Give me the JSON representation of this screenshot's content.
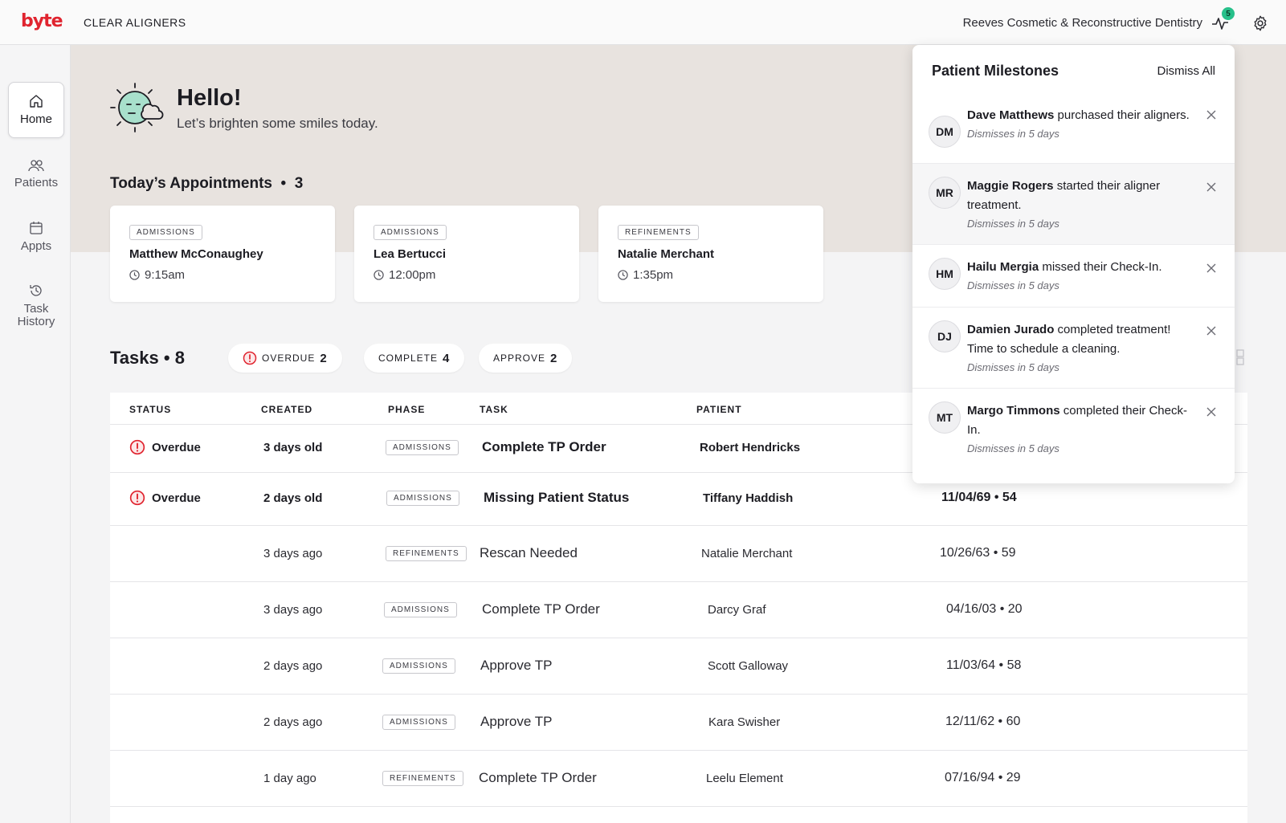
{
  "topbar": {
    "logo": "byte",
    "product": "CLEAR ALIGNERS",
    "practice": "Reeves Cosmetic & Reconstructive Dentistry",
    "notification_count": "5",
    "icons": [
      "pulse-icon",
      "gear-icon"
    ]
  },
  "sidebar": {
    "items": [
      {
        "label": "Home",
        "icon": "home-icon"
      },
      {
        "label": "Patients",
        "icon": "users-icon"
      },
      {
        "label": "Appts",
        "icon": "calendar-icon"
      },
      {
        "label": "Task History",
        "icon": "history-icon"
      }
    ]
  },
  "hero": {
    "title": "Hello!",
    "subtitle": "Let’s brighten some smiles today.",
    "appointments_heading": "Today’s Appointments",
    "appointments_count": "3"
  },
  "appointments": [
    {
      "phase": "ADMISSIONS",
      "name": "Matthew McConaughey",
      "time": "9:15am"
    },
    {
      "phase": "ADMISSIONS",
      "name": "Lea Bertucci",
      "time": "12:00pm"
    },
    {
      "phase": "REFINEMENTS",
      "name": "Natalie Merchant",
      "time": "1:35pm"
    }
  ],
  "tasks": {
    "heading": "Tasks",
    "count": "8",
    "filters": [
      {
        "label": "OVERDUE",
        "count": "2"
      },
      {
        "label": "COMPLETE",
        "count": "4"
      },
      {
        "label": "APPROVE",
        "count": "2"
      }
    ],
    "columns": [
      "STATUS",
      "CREATED",
      "PHASE",
      "TASK",
      "PATIENT"
    ],
    "rows": [
      {
        "status": "Overdue",
        "created": "3 days old",
        "phase": "ADMISSIONS",
        "task": "Complete TP  Order",
        "patient": "Robert Hendricks",
        "dob": ""
      },
      {
        "status": "Overdue",
        "created": "2 days old",
        "phase": "ADMISSIONS",
        "task": "Missing Patient Status",
        "patient": "Tiffany Haddish",
        "dob": "11/04/69 • 54"
      },
      {
        "status": "",
        "created": "3 days ago",
        "phase": "REFINEMENTS",
        "task": "Rescan Needed",
        "patient": "Natalie Merchant",
        "dob": "10/26/63 • 59"
      },
      {
        "status": "",
        "created": "3 days ago",
        "phase": "ADMISSIONS",
        "task": "Complete TP  Order",
        "patient": "Darcy Graf",
        "dob": "04/16/03 • 20"
      },
      {
        "status": "",
        "created": "2 days ago",
        "phase": "ADMISSIONS",
        "task": "Approve TP",
        "patient": "Scott Galloway",
        "dob": "11/03/64 • 58"
      },
      {
        "status": "",
        "created": "2 days ago",
        "phase": "ADMISSIONS",
        "task": "Approve TP",
        "patient": "Kara Swisher",
        "dob": "12/11/62 • 60"
      },
      {
        "status": "",
        "created": "1 day ago",
        "phase": "REFINEMENTS",
        "task": "Complete TP  Order",
        "patient": "Leelu Element",
        "dob": "07/16/94 • 29"
      }
    ]
  },
  "milestones": {
    "title": "Patient Milestones",
    "dismiss_all": "Dismiss All",
    "items": [
      {
        "initials": "DM",
        "name": "Dave Matthews",
        "text": " purchased their aligners.",
        "sub": "Dismisses in 5 days"
      },
      {
        "initials": "MR",
        "name": "Maggie Rogers",
        "text": " started their aligner treatment.",
        "sub": "Dismisses in 5 days"
      },
      {
        "initials": "HM",
        "name": "Hailu Mergia",
        "text": " missed their Check-In.",
        "sub": "Dismisses in 5 days"
      },
      {
        "initials": "DJ",
        "name": "Damien Jurado",
        "text": " completed treatment! Time to schedule a cleaning.",
        "sub": "Dismisses in 5 days"
      },
      {
        "initials": "MT",
        "name": "Margo Timmons",
        "text": " completed their Check-In.",
        "sub": "Dismisses in 5 days"
      }
    ]
  },
  "colors": {
    "brand": "#e0242f",
    "overdue": "#e0242f",
    "badge": "#27c08a",
    "hero_bg": "#e8e3df"
  }
}
